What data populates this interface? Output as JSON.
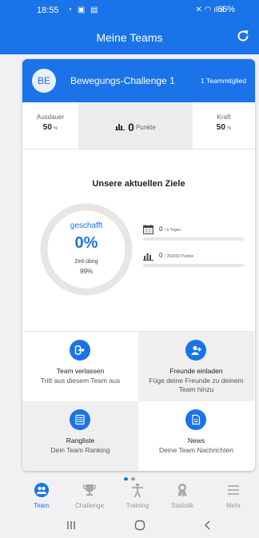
{
  "status_bar": {
    "time": "18:55",
    "signal_text": "66%"
  },
  "app_bar": {
    "title": "Meine Teams",
    "refresh_icon": "refresh-icon"
  },
  "team": {
    "avatar": "BE",
    "name": "Bewegungs-Challenge 1",
    "members": "1 Teammitglied"
  },
  "stats": {
    "endurance_label": "Ausdauer",
    "endurance_value": "50",
    "endurance_unit": "%",
    "points_value": "0",
    "points_unit": "Punkte",
    "strength_label": "Kraft",
    "strength_value": "50",
    "strength_unit": "%"
  },
  "goals": {
    "title": "Unsere aktuellen Ziele",
    "achieved_label": "geschafft",
    "achieved_percent": "0%",
    "achieved_fraction": 0,
    "time_left_label": "Zeit übrig",
    "time_left_value": "99%",
    "time_left_fraction": 0.99,
    "days_value": "0",
    "days_total": "/ 6 Tagen",
    "days_fraction": 0,
    "points_value": "0",
    "points_total": "/ 250000 Punkte",
    "points_fraction": 0
  },
  "actions": [
    {
      "title": "Team verlassen",
      "subtitle": "Tritt aus diesem Team aus",
      "icon": "exit-icon"
    },
    {
      "title": "Freunde einladen",
      "subtitle": "Füge deine Freunde zu deinem Team hinzu",
      "icon": "add-user-icon"
    },
    {
      "title": "Rangliste",
      "subtitle": "Dein Team Ranking",
      "icon": "list-icon"
    },
    {
      "title": "News",
      "subtitle": "Deine Team Nachrichten",
      "icon": "document-icon"
    }
  ],
  "nav": [
    {
      "label": "Team",
      "icon": "team-icon",
      "active": true
    },
    {
      "label": "Challenge",
      "icon": "trophy-icon",
      "active": false
    },
    {
      "label": "Training",
      "icon": "person-icon",
      "active": false
    },
    {
      "label": "Statistik",
      "icon": "badge-icon",
      "active": false
    },
    {
      "label": "Mehr",
      "icon": "menu-icon",
      "active": false
    }
  ],
  "pager": {
    "pages": 2,
    "current": 1
  },
  "colors": {
    "primary": "#1a73e8",
    "inactive": "#a8a8a8",
    "track": "#e6e6e6"
  }
}
